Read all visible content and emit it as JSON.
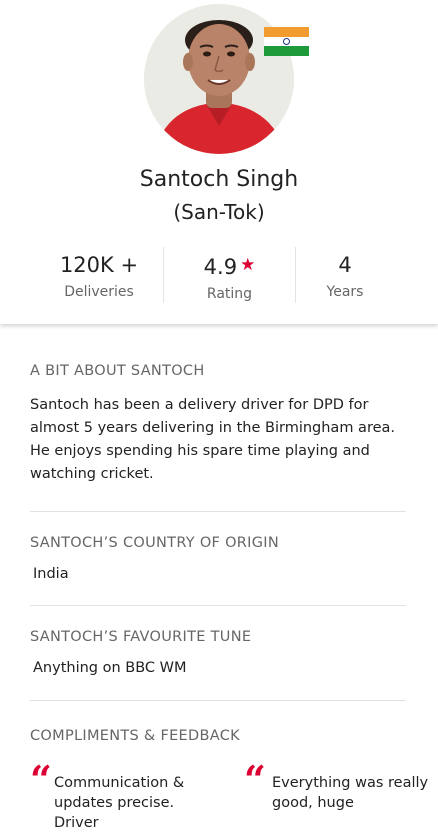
{
  "driver": {
    "name": "Santoch Singh",
    "pronunciation": "(San-Tok)",
    "country_flag_icon": "india-flag-icon"
  },
  "stats": [
    {
      "value": "120K +",
      "label": "Deliveries"
    },
    {
      "value": "4.9",
      "label": "Rating",
      "star": "★"
    },
    {
      "value": "4",
      "label": "Years"
    }
  ],
  "about": {
    "title": "A BIT ABOUT SANTOCH",
    "text": "Santoch has been a delivery driver for DPD for almost 5 years delivering in the Birmingham area. He enjoys spending his spare time playing and watching cricket."
  },
  "origin": {
    "title": "SANTOCH’S COUNTRY OF ORIGIN",
    "value": "India"
  },
  "tune": {
    "title": "SANTOCH’S FAVOURITE TUNE",
    "value": "Anything on BBC WM"
  },
  "feedback": {
    "title": "COMPLIMENTS & FEEDBACK",
    "quote_mark": "“",
    "items": [
      {
        "text": "Communication & updates precise. Driver"
      },
      {
        "text": "Everything was really good, huge"
      }
    ]
  },
  "colors": {
    "accent": "#dc0032",
    "flag_saffron": "#f29b2f",
    "flag_green": "#1f9a3b"
  }
}
